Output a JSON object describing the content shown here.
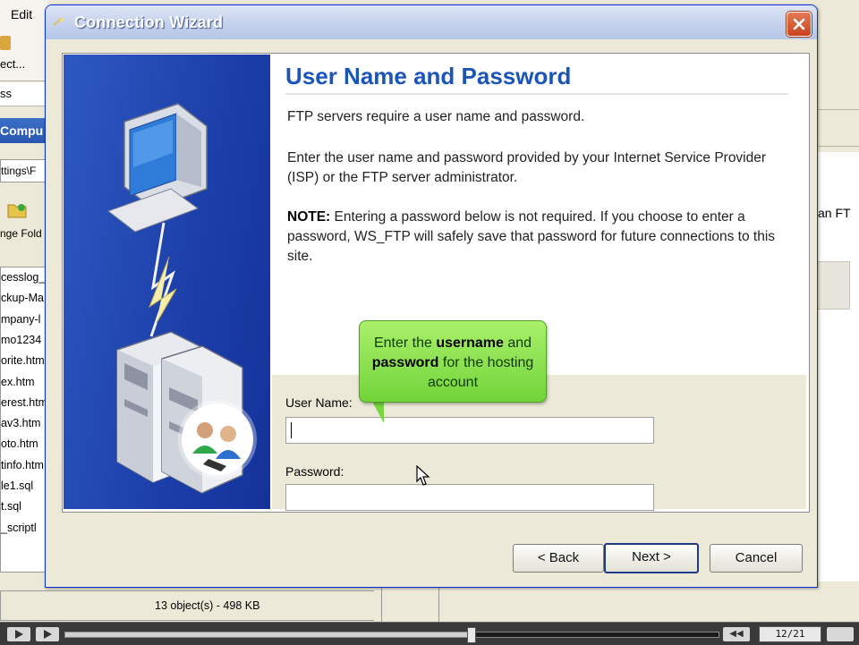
{
  "background_app": {
    "menu_edit": "Edit",
    "toolbar_label": "ect...",
    "address_label": "ss",
    "panel_title": "Compu",
    "path_text": "ttings\\F",
    "folder_label": "nge Fold",
    "files": [
      "cesslog_",
      "ckup-Ma",
      "mpany-l",
      "mo1234",
      "orite.htm",
      "ex.htm",
      "erest.htm",
      "av3.htm",
      "oto.htm",
      "tinfo.htm",
      "le1.sql",
      "t.sql",
      "_scriptl"
    ],
    "status": "13 object(s) - 498 KB",
    "right_text": "an FT"
  },
  "dialog": {
    "title": "Connection Wizard",
    "heading": "User Name and Password",
    "para1": "FTP servers require a user name and password.",
    "para2": "Enter the user name and password provided by your Internet Service Provider (ISP) or the FTP server administrator.",
    "note_label": "NOTE:",
    "note_text": " Entering a password below is not required. If you choose to enter a password, WS_FTP will safely save that password for future connections to this site.",
    "callout": {
      "prefix": "Enter the ",
      "bold1": "username",
      "mid": " and ",
      "bold2": "password",
      "suffix": " for the hosting account"
    },
    "username_label": "User Name:",
    "username_value": "",
    "password_label": "Password:",
    "password_value": "",
    "buttons": {
      "back": "< Back",
      "next": "Next >",
      "cancel": "Cancel"
    }
  },
  "player": {
    "counter": "12/21",
    "progress": 0.62
  },
  "colors": {
    "heading": "#1c55b8",
    "title_bar": "#c7d3ee",
    "wizard_panel": "#1c3ea8",
    "callout": "#8ee35a"
  }
}
